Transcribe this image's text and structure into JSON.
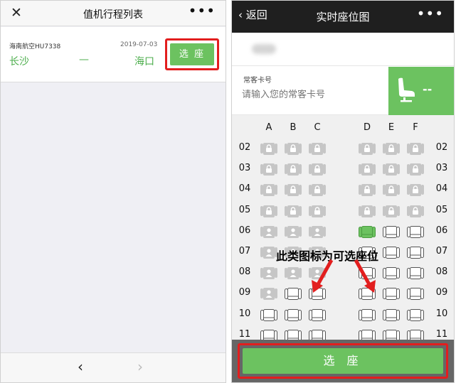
{
  "left": {
    "title": "值机行程列表",
    "close_icon": "close-icon",
    "more_icon": "more-icon",
    "flight": {
      "airline": "海南航空HU7338",
      "date": "2019-07-03",
      "from": "长沙",
      "separator": "—",
      "to": "海口",
      "select_label": "选 座"
    },
    "nav": {
      "back": "‹",
      "forward": "›"
    }
  },
  "right": {
    "back_label": "返回",
    "title": "实时座位图",
    "passenger_name_blurred": true,
    "frequent_flyer": {
      "label": "常客卡号",
      "placeholder": "请输入您的常客卡号",
      "selected_seat": "--"
    },
    "seat_columns": [
      "A",
      "B",
      "C",
      "D",
      "E",
      "F"
    ],
    "seat_rows": [
      {
        "row": "02",
        "seats": [
          "locked",
          "locked",
          "locked",
          "locked",
          "locked",
          "locked"
        ]
      },
      {
        "row": "03",
        "seats": [
          "locked",
          "locked",
          "locked",
          "locked",
          "locked",
          "locked"
        ]
      },
      {
        "row": "04",
        "seats": [
          "locked",
          "locked",
          "locked",
          "locked",
          "locked",
          "locked"
        ]
      },
      {
        "row": "05",
        "seats": [
          "locked",
          "locked",
          "locked",
          "locked",
          "locked",
          "locked"
        ]
      },
      {
        "row": "06",
        "seats": [
          "occupied",
          "occupied",
          "occupied",
          "selected",
          "available",
          "available"
        ]
      },
      {
        "row": "07",
        "seats": [
          "occupied",
          "occupied",
          "occupied",
          "available",
          "available",
          "available"
        ]
      },
      {
        "row": "08",
        "seats": [
          "occupied",
          "occupied",
          "occupied",
          "available",
          "available",
          "available"
        ]
      },
      {
        "row": "09",
        "seats": [
          "occupied",
          "available",
          "available",
          "available",
          "available",
          "available"
        ]
      },
      {
        "row": "10",
        "seats": [
          "available",
          "available",
          "available",
          "available",
          "available",
          "available"
        ]
      },
      {
        "row": "11",
        "seats": [
          "available",
          "available",
          "available",
          "available",
          "available",
          "available"
        ]
      }
    ],
    "annotation": "此类图标为可选座位",
    "confirm_label": "选 座"
  },
  "colors": {
    "green": "#6cc260",
    "red_highlight": "#e21e1e",
    "dark_header": "#1f1f1f"
  }
}
